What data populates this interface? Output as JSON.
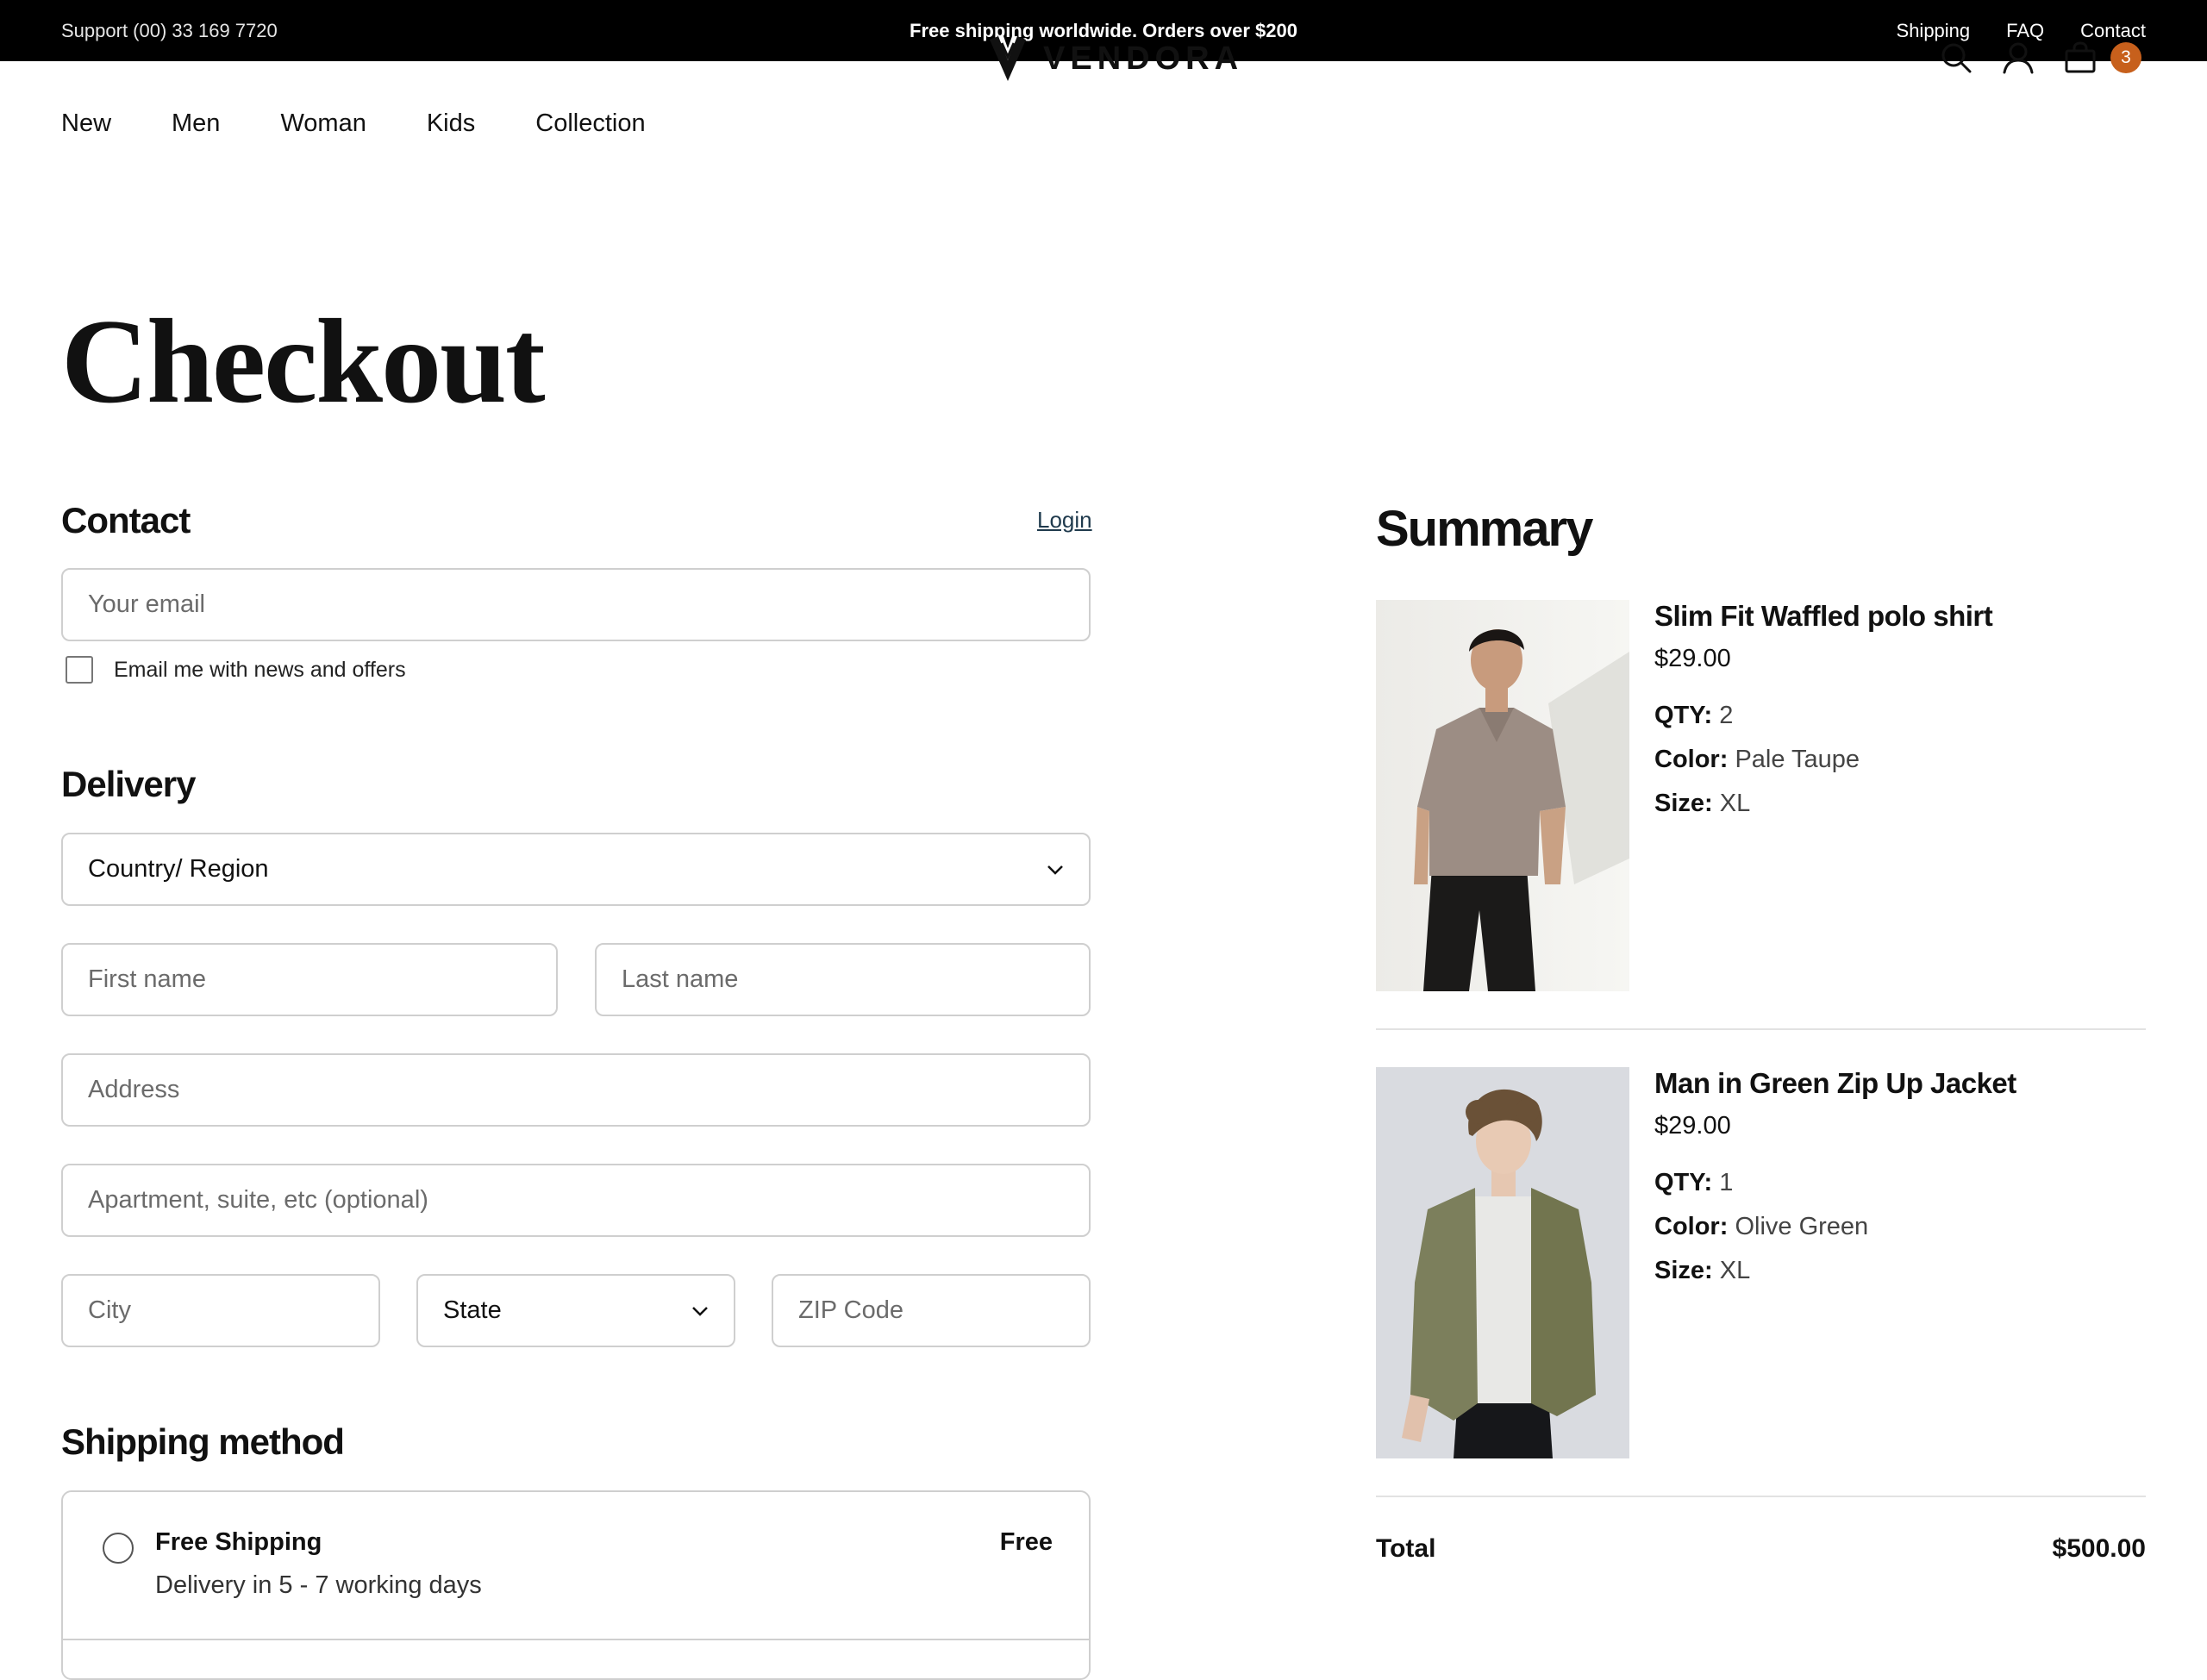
{
  "topbar": {
    "support": "Support (00) 33 169 7720",
    "promo": "Free shipping worldwide. Orders over $200",
    "links": [
      "Shipping",
      "FAQ",
      "Contact"
    ]
  },
  "nav": {
    "menu": [
      "New",
      "Men",
      "Woman",
      "Kids",
      "Collection"
    ],
    "brand": "VENDORA",
    "cart_count": "3",
    "icons": [
      "search-icon",
      "user-icon",
      "bag-icon"
    ]
  },
  "page_title": "Checkout",
  "contact": {
    "title": "Contact",
    "login": "Login",
    "email_placeholder": "Your email",
    "newsletter_label": "Email me with news and offers"
  },
  "delivery": {
    "title": "Delivery",
    "country": "Country/ Region",
    "first_name_placeholder": "First name",
    "last_name_placeholder": "Last name",
    "address_placeholder": "Address",
    "apartment_placeholder": "Apartment, suite, etc (optional)",
    "city_placeholder": "City",
    "state": "State",
    "zip_placeholder": "ZIP Code"
  },
  "shipping": {
    "title": "Shipping method",
    "options": [
      {
        "name": "Free Shipping",
        "desc": "Delivery in 5 - 7 working days",
        "price": "Free"
      }
    ]
  },
  "summary": {
    "title": "Summary",
    "qty_label": "QTY:",
    "color_label": "Color:",
    "size_label": "Size:",
    "items": [
      {
        "name": "Slim Fit Waffled polo shirt",
        "price": "$29.00",
        "qty": "2",
        "color": "Pale Taupe",
        "size": "XL"
      },
      {
        "name": "Man in Green Zip Up Jacket",
        "price": "$29.00",
        "qty": "1",
        "color": "Olive Green",
        "size": "XL"
      }
    ],
    "total_label": "Total",
    "total_value": "$500.00"
  },
  "colors": {
    "topbar_bg": "#000000",
    "badge": "#c7601c",
    "border": "#cfcfcf"
  }
}
